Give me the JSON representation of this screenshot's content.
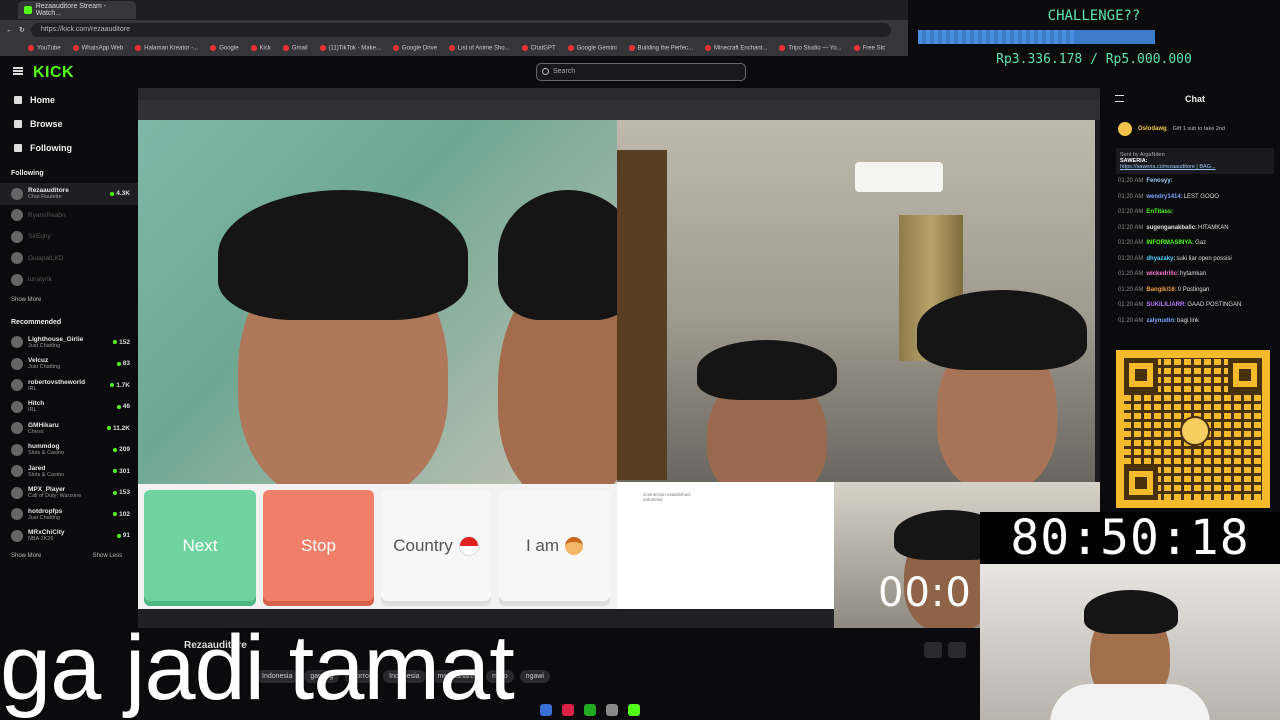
{
  "browser": {
    "tab_title": "Rezaauditore Stream - Watch...",
    "url": "https://kick.com/rezaauditore",
    "bookmarks": [
      "YouTube",
      "WhatsApp Web",
      "Halaman Kreator -...",
      "Google",
      "Kick",
      "Gmail",
      "(11)TikTok - Make...",
      "Google Drive",
      "List of Anime Sho...",
      "ChatGPT",
      "Google Gemini",
      "Building the Perfec...",
      "Minecraft Enchant...",
      "Tripo Studio — Yo...",
      "Free Stc"
    ]
  },
  "kick": {
    "logo": "KICK",
    "search_placeholder": "Search"
  },
  "sidebar": {
    "nav": [
      {
        "label": "Home"
      },
      {
        "label": "Browse"
      },
      {
        "label": "Following"
      }
    ],
    "following_title": "Following",
    "following": [
      {
        "name": "Rezaauditore",
        "category": "Chat Roulette",
        "viewers": "4.3K",
        "live": true
      },
      {
        "name": "RyansReabn",
        "category": "",
        "viewers": "",
        "live": false
      },
      {
        "name": "SirEqhy",
        "category": "",
        "viewers": "",
        "live": false
      },
      {
        "name": "GulapatLKD",
        "category": "",
        "viewers": "",
        "live": false
      },
      {
        "name": "lunalyrik",
        "category": "",
        "viewers": "",
        "live": false
      }
    ],
    "show_more": "Show More",
    "recommended_title": "Recommended",
    "recommended": [
      {
        "name": "Lighthouse_Girlie",
        "category": "Just Chatting",
        "viewers": "152"
      },
      {
        "name": "Velcuz",
        "category": "Just Chatting",
        "viewers": "83"
      },
      {
        "name": "robertovstheworld",
        "category": "IRL",
        "viewers": "1.7K"
      },
      {
        "name": "Hitch",
        "category": "IRL",
        "viewers": "46"
      },
      {
        "name": "GMHikaru",
        "category": "Chess",
        "viewers": "11.2K"
      },
      {
        "name": "hummdog",
        "category": "Slots & Casino",
        "viewers": "209"
      },
      {
        "name": "Jared",
        "category": "Slots & Casino",
        "viewers": "301"
      },
      {
        "name": "MPX_Player",
        "category": "Call of Duty: Warzone",
        "viewers": "153"
      },
      {
        "name": "hotdropfps",
        "category": "Just Chatting",
        "viewers": "102"
      },
      {
        "name": "MRxChiCity",
        "category": "NBA 2K26",
        "viewers": "91"
      }
    ],
    "show_more_rec": "Show More",
    "show_less": "Show Less"
  },
  "ometv": {
    "btn_next": "Next",
    "btn_stop": "Stop",
    "btn_country": "Country",
    "btn_iam": "I am",
    "chat_system": "Connection established.",
    "chat_country": "Indonesia"
  },
  "stream_timer": "00:0",
  "stream_info": {
    "name": "Rezaauditore",
    "tags": [
      "Indonesia",
      "gaming",
      "Horror",
      "Indonesia",
      "mediashare",
      "mmo",
      "ngawi"
    ]
  },
  "caption": "ga jadi tamat",
  "chat": {
    "title": "Chat",
    "pinned_user": "Oslodawg",
    "pinned_text": "Gift 1 sub to take 2nd",
    "saweria_sent": "Sent by ArgaNden",
    "saweria_label": "SAWERIA:",
    "saweria_link": "https://saweria.co/rezaauditore | BAG...",
    "messages": [
      {
        "time": "01:20 AM",
        "user": "Fenosyy:",
        "text": "",
        "color": "#9ec8ff"
      },
      {
        "time": "01:20 AM",
        "user": "wendry1414:",
        "text": "LEST GOOO",
        "color": "#7aa7ff"
      },
      {
        "time": "01:20 AM",
        "user": "EnTitass:",
        "text": "",
        "color": "#53fc18"
      },
      {
        "time": "01:20 AM",
        "user": "sugenganakbalic:",
        "text": "HITAMKAN",
        "color": "#e0e0e0"
      },
      {
        "time": "01:20 AM",
        "user": "INFORMASINYA:",
        "text": "Gaz",
        "color": "#53fc18"
      },
      {
        "time": "01:20 AM",
        "user": "dhyazaky:",
        "text": "suki liar open possisi",
        "color": "#4fd1ff"
      },
      {
        "time": "01:20 AM",
        "user": "wickedrilic:",
        "text": "hytamkan",
        "color": "#ff7ac8"
      },
      {
        "time": "01:20 AM",
        "user": "Bangiki16:",
        "text": "0 Postingan",
        "color": "#f0a040"
      },
      {
        "time": "01:20 AM",
        "user": "SUKILILIARR:",
        "text": "GAAD POSTINGAN",
        "color": "#b37aff"
      },
      {
        "time": "01:20 AM",
        "user": "zalynudin:",
        "text": "bagi link",
        "color": "#7aa7ff"
      }
    ]
  },
  "challenge": {
    "title": "CHALLENGE??",
    "amount": "Rp3.336.178 / Rp5.000.000",
    "progress": 0.667
  },
  "big_timer": "80:50:18"
}
